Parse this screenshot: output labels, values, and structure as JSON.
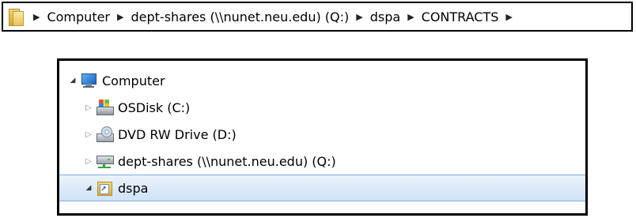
{
  "breadcrumb": {
    "icon": "folder-icon",
    "separator": "▶",
    "items": [
      "Computer",
      "dept-shares (\\\\nunet.neu.edu) (Q:)",
      "dspa",
      "CONTRACTS"
    ]
  },
  "tree": {
    "root": {
      "label": "Computer",
      "expander": "◢",
      "icon": "computer-icon"
    },
    "children": [
      {
        "label": "OSDisk (C:)",
        "expander": "▷",
        "icon": "hard-disk-icon"
      },
      {
        "label": "DVD RW Drive (D:)",
        "expander": "▷",
        "icon": "dvd-drive-icon"
      },
      {
        "label": "dept-shares (\\\\nunet.neu.edu) (Q:)",
        "expander": "▷",
        "icon": "network-drive-icon"
      },
      {
        "label": "dspa",
        "expander": "◢",
        "icon": "shortcut-folder-icon",
        "selected": true
      }
    ]
  },
  "colors": {
    "selection_top": "#eaf3fc",
    "selection_bottom": "#cfe3f8",
    "selection_border": "#84acdd"
  }
}
